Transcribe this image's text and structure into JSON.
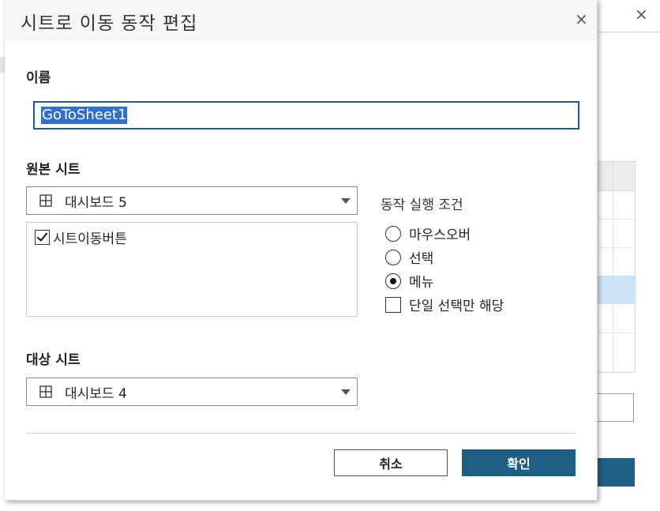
{
  "dialog": {
    "title": "시트로 이동 동작 편집",
    "close_glyph": "×"
  },
  "name_section": {
    "label": "이름",
    "value": "GoToSheet1"
  },
  "source_section": {
    "label": "원본 시트",
    "selected_sheet": "대시보드 5",
    "items": [
      {
        "label": "시트이동버튼",
        "checked": true
      }
    ]
  },
  "run_on": {
    "label": "동작 실행 조건",
    "options": [
      {
        "label": "마우스오버",
        "selected": false
      },
      {
        "label": "선택",
        "selected": false
      },
      {
        "label": "메뉴",
        "selected": true
      }
    ],
    "single_select": {
      "label": "단일 선택만 해당",
      "checked": false
    }
  },
  "target_section": {
    "label": "대상 시트",
    "selected_sheet": "대시보드 4"
  },
  "buttons": {
    "cancel": "취소",
    "ok": "확인"
  },
  "background_window": {
    "close_glyph": "×"
  },
  "colors": {
    "accent": "#1f5f86",
    "selection": "#2f6fd0"
  }
}
